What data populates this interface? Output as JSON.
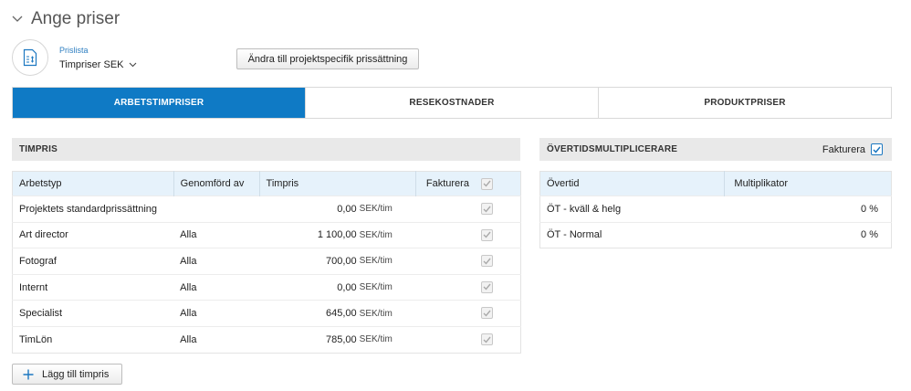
{
  "page": {
    "title": "Ange priser"
  },
  "pricelist": {
    "label": "Prislista",
    "value": "Timpriser SEK"
  },
  "change_button": {
    "label": "Ändra till projektspecifik prissättning"
  },
  "tabs": [
    {
      "label": "ARBETSTIMPRISER",
      "active": true
    },
    {
      "label": "RESEKOSTNADER",
      "active": false
    },
    {
      "label": "PRODUKTPRISER",
      "active": false
    }
  ],
  "timpris": {
    "title": "TIMPRIS",
    "columns": {
      "arbetstyp": "Arbetstyp",
      "genomford": "Genomförd av",
      "timpris": "Timpris",
      "fakturera": "Fakturera"
    },
    "rows": [
      {
        "arbetstyp": "Projektets standardprissättning",
        "genomford": "",
        "price": "0,00",
        "unit": "SEK/tim"
      },
      {
        "arbetstyp": "Art director",
        "genomford": "Alla",
        "price": "1 100,00",
        "unit": "SEK/tim"
      },
      {
        "arbetstyp": "Fotograf",
        "genomford": "Alla",
        "price": "700,00",
        "unit": "SEK/tim"
      },
      {
        "arbetstyp": "Internt",
        "genomford": "Alla",
        "price": "0,00",
        "unit": "SEK/tim"
      },
      {
        "arbetstyp": "Specialist",
        "genomford": "Alla",
        "price": "645,00",
        "unit": "SEK/tim"
      },
      {
        "arbetstyp": "TimLön",
        "genomford": "Alla",
        "price": "785,00",
        "unit": "SEK/tim"
      }
    ],
    "add_button": "Lägg till timpris"
  },
  "overtid": {
    "title": "ÖVERTIDSMULTIPLICERARE",
    "fakturera_label": "Fakturera",
    "columns": {
      "overtid": "Övertid",
      "multiplikator": "Multiplikator"
    },
    "rows": [
      {
        "name": "ÖT - kväll & helg",
        "value": "0 %"
      },
      {
        "name": "ÖT - Normal",
        "value": "0 %"
      }
    ]
  },
  "colors": {
    "accent": "#0f7ac5",
    "header_bg": "#e9e9e9",
    "table_head_bg": "#e6f2fb",
    "link": "#2f7fc1"
  }
}
